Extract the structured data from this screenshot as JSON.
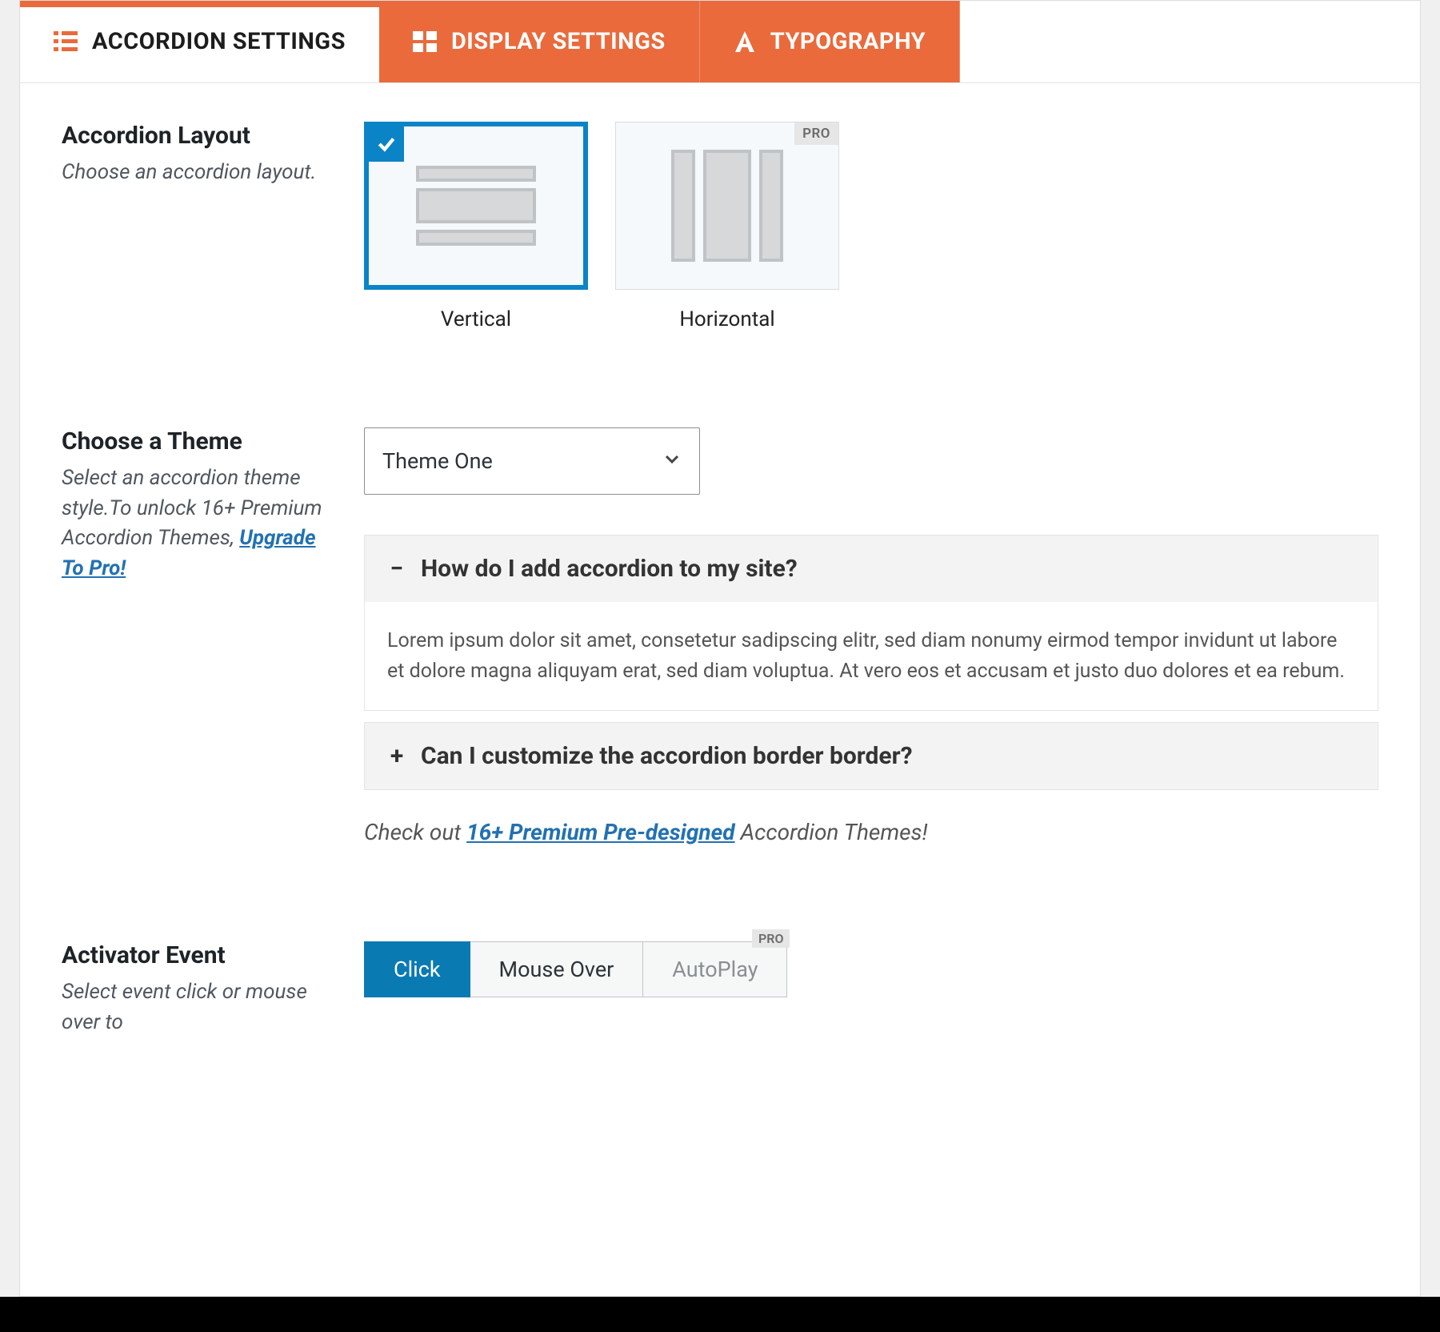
{
  "tabs": {
    "accordion": "ACCORDION SETTINGS",
    "display": "DISPLAY SETTINGS",
    "typography": "TYPOGRAPHY"
  },
  "layout": {
    "title": "Accordion Layout",
    "desc": "Choose an accordion layout.",
    "vertical": "Vertical",
    "horizontal": "Horizontal",
    "pro": "PRO"
  },
  "theme": {
    "title": "Choose a Theme",
    "desc_pre": "Select an accordion theme style.To unlock 16+ Premium Accordion Themes, ",
    "upgrade": "Upgrade To Pro!",
    "selected": "Theme One",
    "acc1_title": "How do I add accordion to my site?",
    "acc1_body": "Lorem ipsum dolor sit amet, consetetur sadipscing elitr, sed diam nonumy eirmod tempor invidunt ut labore et dolore magna aliquyam erat, sed diam voluptua. At vero eos et accusam et justo duo dolores et ea rebum.",
    "acc2_title": "Can I customize the accordion border border?",
    "check_pre": "Check out ",
    "check_link": "16+ Premium Pre-designed",
    "check_post": " Accordion Themes!"
  },
  "activator": {
    "title": "Activator Event",
    "desc": "Select event click or mouse over to",
    "click": "Click",
    "mouse": "Mouse Over",
    "auto": "AutoPlay",
    "pro": "PRO"
  }
}
